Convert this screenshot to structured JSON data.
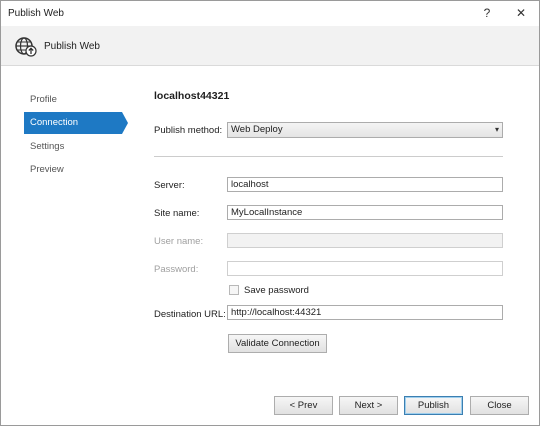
{
  "window": {
    "title": "Publish Web",
    "help_glyph": "?",
    "close_glyph": "✕"
  },
  "header": {
    "title": "Publish Web",
    "icon": "globe-publish-icon"
  },
  "nav": {
    "items": [
      {
        "label": "Profile",
        "active": false
      },
      {
        "label": "Connection",
        "active": true
      },
      {
        "label": "Settings",
        "active": false
      },
      {
        "label": "Preview",
        "active": false
      }
    ]
  },
  "profile": {
    "name": "localhost44321"
  },
  "form": {
    "publish_method": {
      "label": "Publish method:",
      "value": "Web Deploy"
    },
    "server": {
      "label": "Server:",
      "value": "localhost"
    },
    "site_name": {
      "label": "Site name:",
      "value": "MyLocalInstance"
    },
    "user_name": {
      "label": "User name:",
      "value": ""
    },
    "password": {
      "label": "Password:",
      "value": ""
    },
    "save_password": {
      "label": "Save password",
      "checked": false
    },
    "destination_url": {
      "label": "Destination URL:",
      "value": "http://localhost:44321"
    },
    "validate_button": "Validate Connection"
  },
  "footer": {
    "prev": "< Prev",
    "next": "Next >",
    "publish": "Publish",
    "close": "Close"
  },
  "colors": {
    "accent": "#1e79c4"
  }
}
